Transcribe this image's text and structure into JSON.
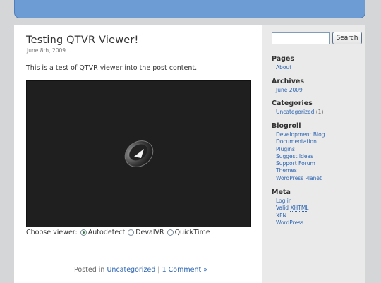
{
  "post": {
    "title": "Testing QTVR Viewer!",
    "date": "June 8th, 2009",
    "body": "This is a test of QTVR viewer into the post content.",
    "viewer_label": "Choose viewer:",
    "viewer_options": [
      {
        "label": "Autodetect",
        "selected": true
      },
      {
        "label": "DevalVR",
        "selected": false
      },
      {
        "label": "QuickTime",
        "selected": false
      }
    ],
    "meta": {
      "posted_in": "Posted in",
      "category": "Uncategorized",
      "separator": "|",
      "comments": "1 Comment »"
    }
  },
  "sidebar": {
    "search": {
      "value": "",
      "button": "Search"
    },
    "pages": {
      "heading": "Pages",
      "items": [
        "About"
      ]
    },
    "archives": {
      "heading": "Archives",
      "items": [
        "June 2009"
      ]
    },
    "categories": {
      "heading": "Categories",
      "item": "Uncategorized",
      "count": "(1)"
    },
    "blogroll": {
      "heading": "Blogroll",
      "items": [
        "Development Blog",
        "Documentation",
        "Plugins",
        "Suggest Ideas",
        "Support Forum",
        "Themes",
        "WordPress Planet"
      ]
    },
    "meta": {
      "heading": "Meta",
      "log_in": "Log in",
      "valid": "Valid",
      "xhtml": "XHTML",
      "xfn": "XFN",
      "wordpress": "WordPress"
    }
  },
  "colors": {
    "header": "#6d9cd4",
    "link": "#2e66b3",
    "sidebar_bg": "#eaeaea",
    "background": "#d5d6d7"
  }
}
